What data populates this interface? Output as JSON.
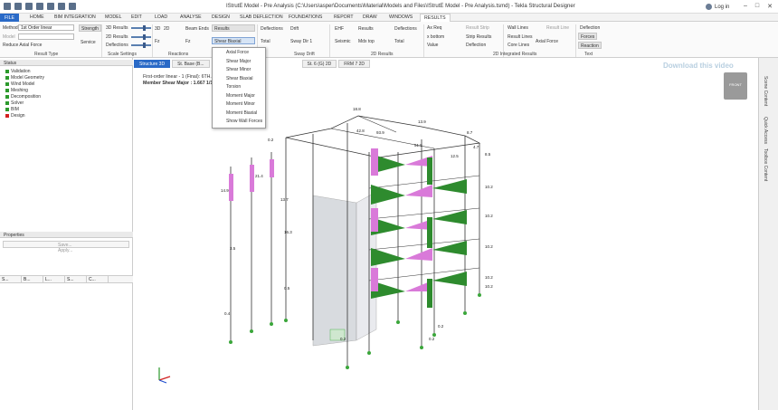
{
  "window": {
    "title": "IStrutE Model - Pre Analysis (C:\\Users\\asper\\Documents\\Material\\Models and Files\\IStrutE Model - Pre Analysis.tsmd) - Tekla Structural Designer",
    "login": "Log in",
    "controls": [
      "–",
      "□",
      "✕"
    ]
  },
  "tabs": [
    "FILE",
    "HOME",
    "BIM INTEGRATION",
    "MODEL",
    "EDIT",
    "LOAD",
    "ANALYSE",
    "DESIGN",
    "SLAB DEFLECTION",
    "FOUNDATIONS",
    "REPORT",
    "DRAW",
    "WINDOWS",
    "RESULTS"
  ],
  "active_tab": "RESULTS",
  "ribbon": {
    "method_label": "Method",
    "method_value": "1st Order linear",
    "model_label": "Model",
    "reduce_axial": "Reduce Axial Force",
    "strength": "Strength",
    "service": "Service",
    "results_3d": "3D Results",
    "results_2d": "2D Results",
    "deflections": "Deflections",
    "btn_3d": "3D",
    "btn_2d": "2D",
    "beam_ends": "Beam Ends",
    "results": "Results",
    "fz": "Fz",
    "shear_biaxial": "Shear Biaxial",
    "deflections2": "Deflections",
    "total": "Total",
    "drift": "Drift",
    "sway_dir": "Sway Dir 1",
    "ehf": "EHF",
    "seismic": "Seismic",
    "results2": "Results",
    "mdx_top": "Mdx top",
    "deflections3": "Deflections",
    "total2": "Total",
    "ax_req": "Ax Req",
    "x_bottom": "x bottom",
    "value": "Value",
    "result_strip": "Result Strip",
    "strip_results": "Strip Results",
    "deflection": "Deflection",
    "wall_lines": "Wall Lines",
    "result_lines": "Result Lines",
    "core_lines": "Core Lines",
    "axial_force": "Axial Force",
    "result_line": "Result Line",
    "deflection2": "Deflection",
    "forces": "Forces",
    "reaction": "Reaction",
    "groups": [
      "Result Type",
      "Scale Settings",
      "Reactions",
      "Sway Drift",
      "2D Results",
      "2D Integrated Results",
      "Text"
    ]
  },
  "dropdown": {
    "items": [
      "Axial Force",
      "Shear Major",
      "Shear Minor",
      "Shear Biaxial",
      "Torsion",
      "Moment Major",
      "Moment Minor",
      "Moment Biaxial",
      "Show Wall Forces"
    ]
  },
  "status_panel": {
    "title": "Status",
    "items": [
      {
        "label": "Validation",
        "state": "ok"
      },
      {
        "label": "Model Geometry",
        "state": "ok"
      },
      {
        "label": "Wind Model",
        "state": "ok"
      },
      {
        "label": "Meshing",
        "state": "ok"
      },
      {
        "label": "Decomposition",
        "state": "ok"
      },
      {
        "label": "Solver",
        "state": "ok"
      },
      {
        "label": "BIM",
        "state": "ok"
      },
      {
        "label": "Design",
        "state": "error"
      }
    ]
  },
  "panel_tabs": [
    "S...",
    "B...",
    "L...",
    "S...",
    "C..."
  ],
  "properties": {
    "title": "Properties",
    "save": "Save...",
    "apply": "Apply..."
  },
  "view_tabs": [
    "Structure 3D",
    "St. Base (B...",
    "",
    "",
    "St. 6 (G) 2D",
    "FRM 7 2D"
  ],
  "active_view": "Structure 3D",
  "overlay": {
    "line1": "First-order linear - 1 (Final): 6TH...",
    "line2": "Member Shear Major : 1.667 1/16"
  },
  "watermark": "Download this video",
  "side_tabs": [
    "Scene Content",
    "Quick Access",
    "Toolbox Content"
  ],
  "cube_label": "FRONT",
  "labels": [
    "18.8",
    "13.9",
    "8.7",
    "42.8",
    "93.9",
    "51.5",
    "12.5",
    "4.7",
    "8.5",
    "10.2",
    "10.2",
    "10.2",
    "10.2",
    "10.2",
    "14.9",
    "21.4",
    "0.2",
    "13.7",
    "16.3",
    "0.5",
    "0.2",
    "0.4",
    "0.2",
    "3.5",
    "0.2"
  ]
}
